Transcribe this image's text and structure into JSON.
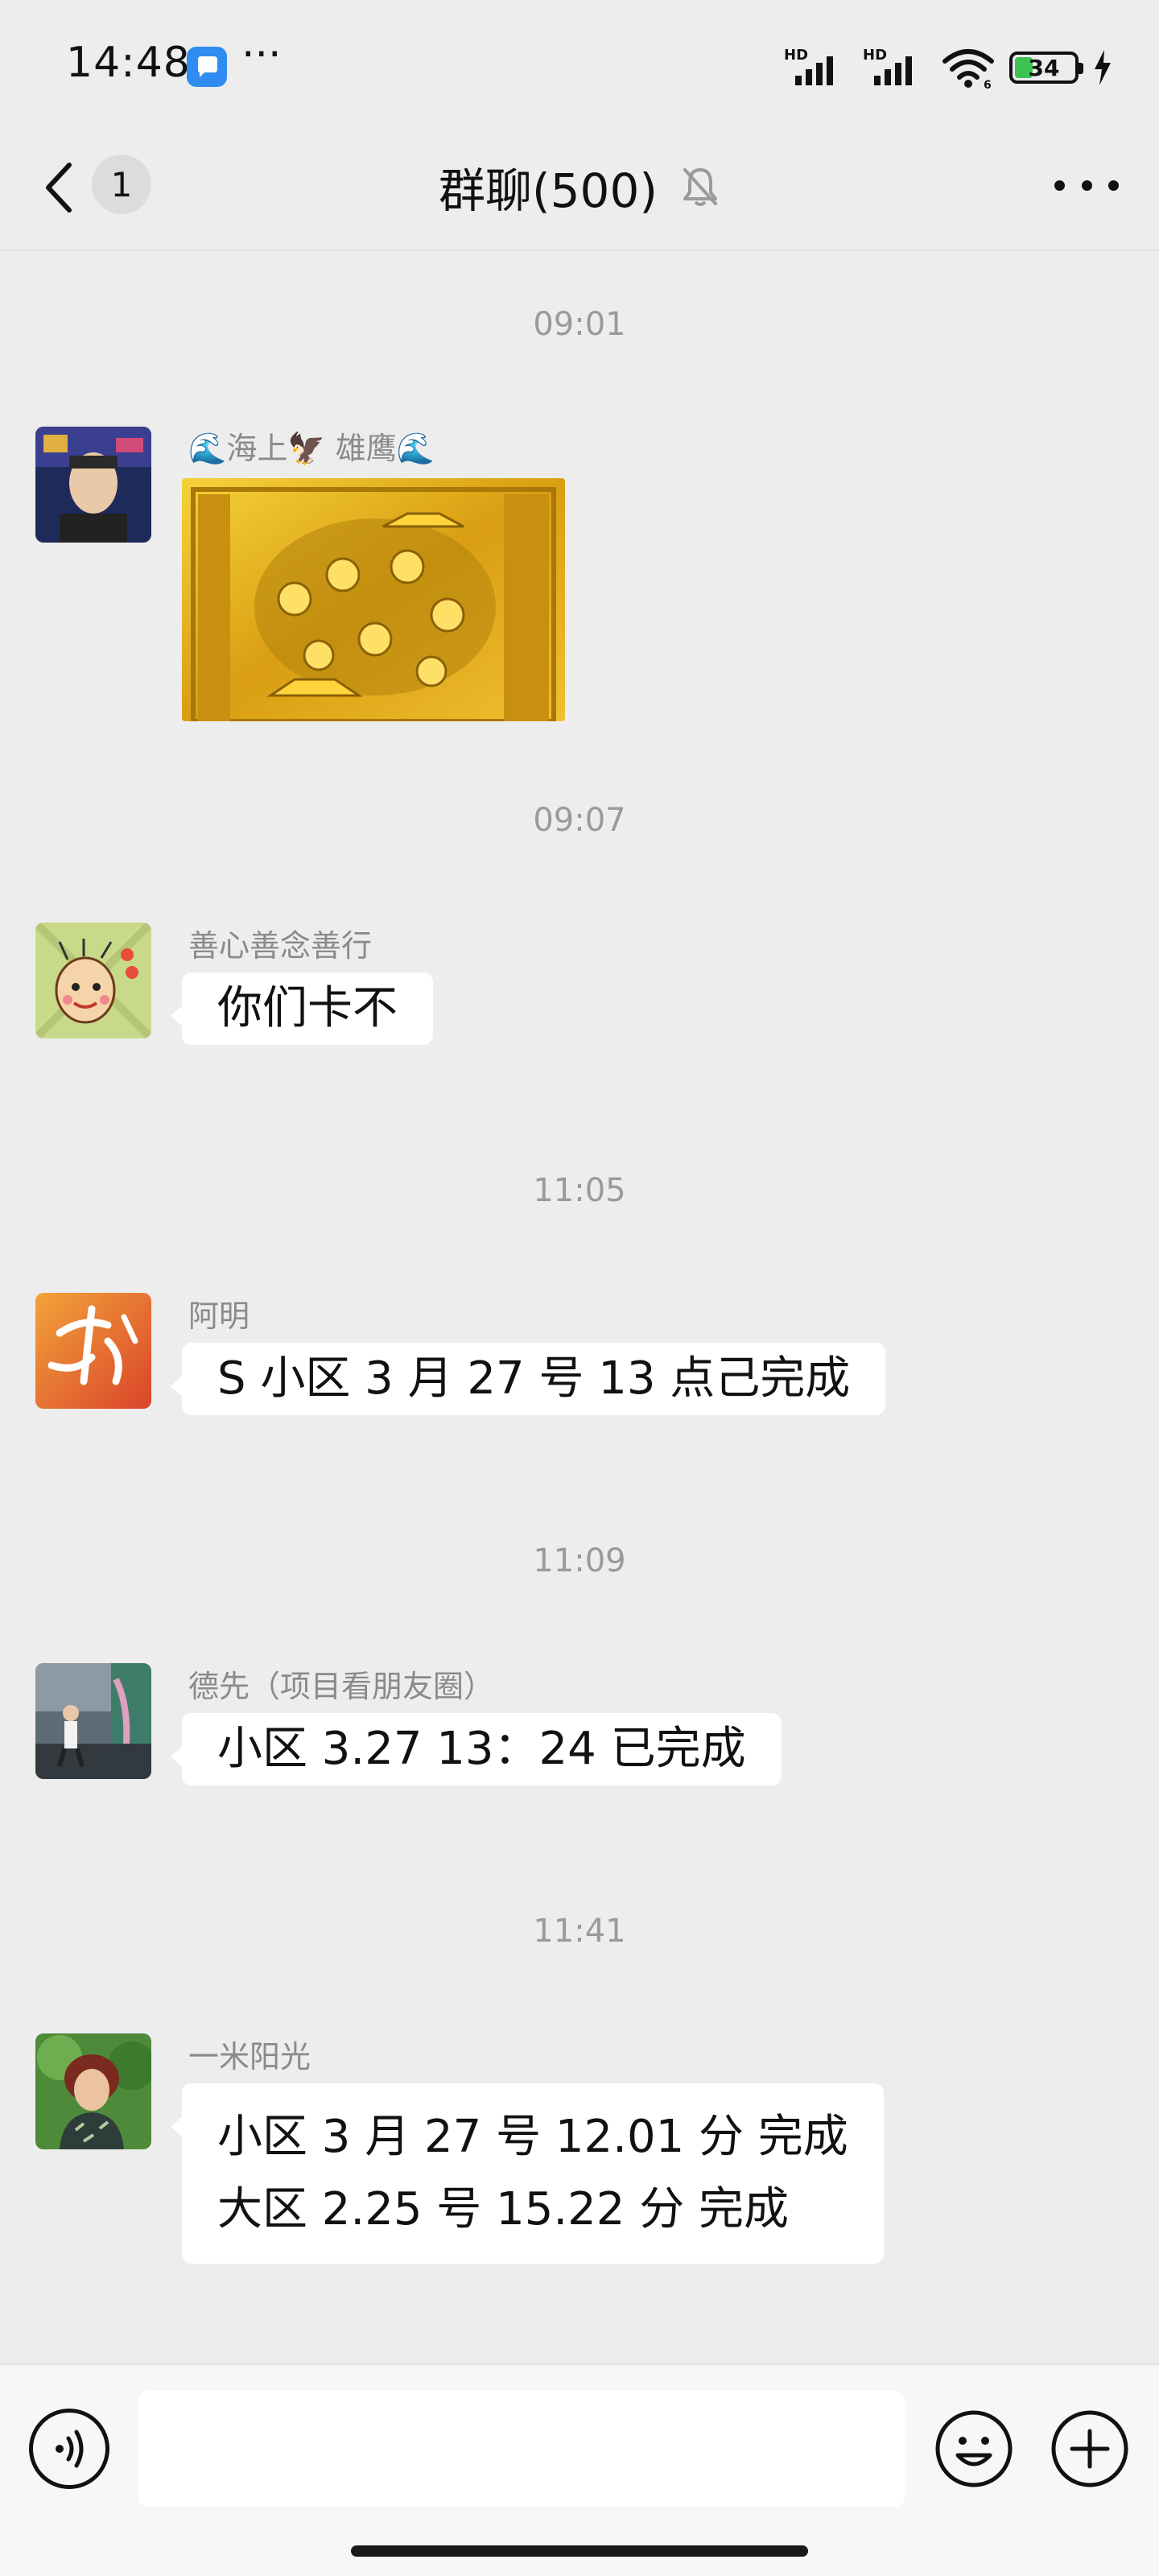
{
  "status_bar": {
    "time": "14:48",
    "app_icon": "bubble-app-icon",
    "more_dots": "···",
    "signal1_label": "HD",
    "signal2_label": "HD",
    "battery_level": "34",
    "icons": [
      "signal-icon",
      "signal-icon",
      "wifi-icon",
      "battery-icon",
      "charging-icon"
    ]
  },
  "nav": {
    "back_icon": "chevron-left-icon",
    "unread_count": "1",
    "title": "群聊(500)",
    "mute_icon": "bell-off-icon",
    "more_icon": "more-horizontal-icon"
  },
  "messages": [
    {
      "time": "09:01",
      "sender": "🌊海上🦅 雄鹰🌊",
      "type": "image",
      "image_desc": "gold-treasure-image"
    },
    {
      "time": "09:07",
      "sender": "善心善念善行",
      "type": "text",
      "lines": [
        "你们卡不"
      ]
    },
    {
      "time": "11:05",
      "sender": "阿明",
      "type": "text",
      "lines": [
        "S 小区 3 月 27 号 13 点己完成"
      ]
    },
    {
      "time": "11:09",
      "sender": "德先（项目看朋友圈）",
      "type": "text",
      "lines": [
        "小区 3.27  13：24 已完成"
      ]
    },
    {
      "time": "11:41",
      "sender": "一米阳光",
      "type": "text",
      "lines": [
        "小区 3 月 27 号 12.01 分 完成",
        "大区 2.25 号 15.22 分 完成"
      ]
    }
  ],
  "input_bar": {
    "voice_icon": "voice-icon",
    "input_value": "",
    "emoji_icon": "emoji-icon",
    "plus_icon": "plus-icon"
  },
  "colors": {
    "background": "#ededed",
    "bubble": "#ffffff",
    "timestamp": "#9a9a9a",
    "sender": "#8a8a8a",
    "battery_fill": "#3cc351"
  }
}
